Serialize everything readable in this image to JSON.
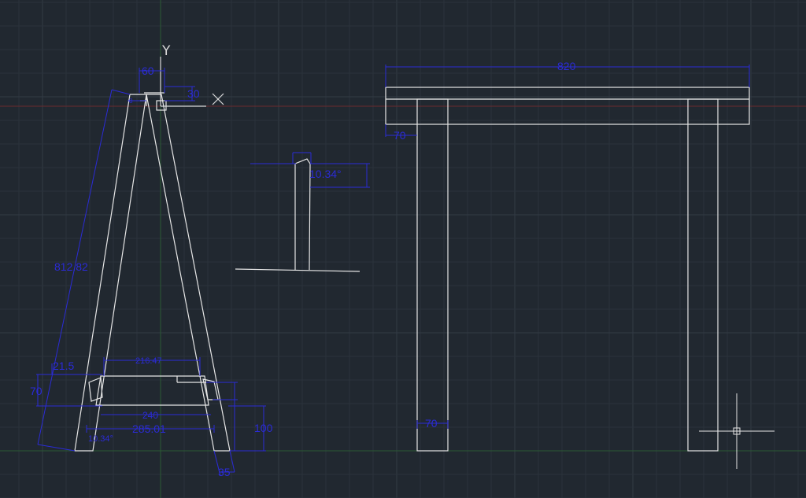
{
  "colors": {
    "background": "#212830",
    "grid_minor": "#2a323b",
    "grid_major": "#323b45",
    "geometry": "#e6e6e6",
    "dimension": "#2b2bd6",
    "x_axis": "#7a2b2b",
    "y_axis": "#2b6b2b"
  },
  "ucs": {
    "x_label": "X",
    "y_label": "Y"
  },
  "dimensions": {
    "top_width": "60",
    "top_height": "30",
    "top_small": "8",
    "leg_length": "812.82",
    "angle_left": "21.5",
    "rail_height": "70",
    "stretcher_top": "216.47",
    "stretcher_mid": "240",
    "stretcher_base": "285.01",
    "angle_bottom": "10.34°",
    "foot_height": "100",
    "foot_width": "35",
    "side_angle": "10.34°",
    "beam_length": "820",
    "beam_leg_offset": "70",
    "leg_width_bottom": "70"
  },
  "icons": {
    "cursor": "crosshair-cursor-icon",
    "ucs": "ucs-axis-icon"
  }
}
